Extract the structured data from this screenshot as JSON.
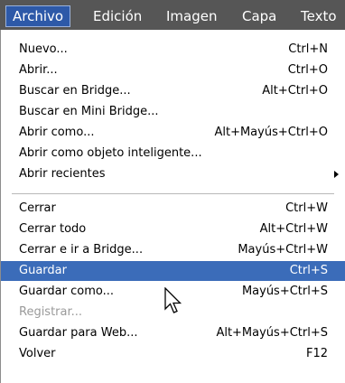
{
  "menubar": {
    "items": [
      {
        "label": "Archivo",
        "active": true
      },
      {
        "label": "Edición"
      },
      {
        "label": "Imagen"
      },
      {
        "label": "Capa"
      },
      {
        "label": "Texto"
      }
    ]
  },
  "menu": {
    "group1": [
      {
        "label": "Nuevo...",
        "shortcut": "Ctrl+N"
      },
      {
        "label": "Abrir...",
        "shortcut": "Ctrl+O"
      },
      {
        "label": "Buscar en Bridge...",
        "shortcut": "Alt+Ctrl+O"
      },
      {
        "label": "Buscar en Mini Bridge...",
        "shortcut": ""
      },
      {
        "label": "Abrir como...",
        "shortcut": "Alt+Mayús+Ctrl+O"
      },
      {
        "label": "Abrir como objeto inteligente...",
        "shortcut": ""
      },
      {
        "label": "Abrir recientes",
        "shortcut": "",
        "submenu": true
      }
    ],
    "group2": [
      {
        "label": "Cerrar",
        "shortcut": "Ctrl+W"
      },
      {
        "label": "Cerrar todo",
        "shortcut": "Alt+Ctrl+W"
      },
      {
        "label": "Cerrar e ir a Bridge...",
        "shortcut": "Mayús+Ctrl+W"
      },
      {
        "label": "Guardar",
        "shortcut": "Ctrl+S",
        "selected": true
      },
      {
        "label": "Guardar como...",
        "shortcut": "Mayús+Ctrl+S"
      },
      {
        "label": "Registrar...",
        "shortcut": "",
        "disabled": true
      },
      {
        "label": "Guardar para Web...",
        "shortcut": "Alt+Mayús+Ctrl+S"
      },
      {
        "label": "Volver",
        "shortcut": "F12"
      }
    ]
  },
  "colors": {
    "menubar_bg": "#565656",
    "active_menu_bg": "#2d59a8",
    "selected_item_bg": "#3b6cb9",
    "disabled_text": "#9a9a9a"
  },
  "icons": {
    "submenu_arrow": "chevron-right-icon",
    "cursor": "mouse-pointer-icon"
  }
}
